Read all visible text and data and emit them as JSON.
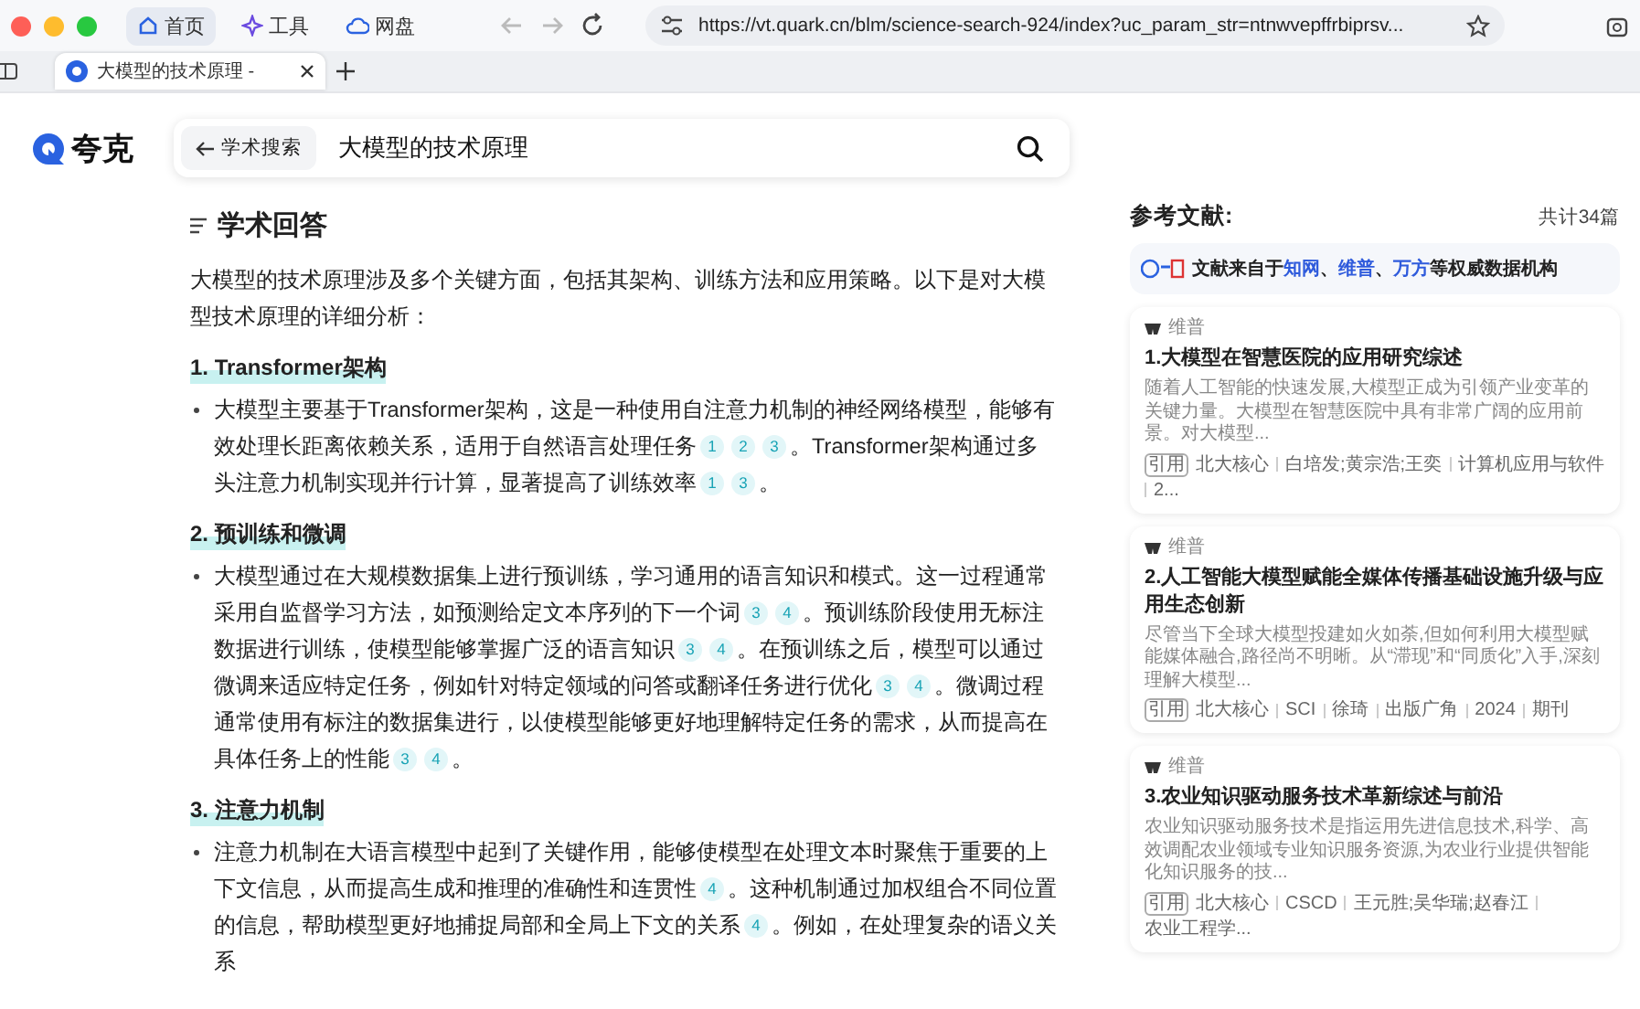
{
  "browser": {
    "nav_tabs": [
      {
        "label": "首页",
        "selected": true
      },
      {
        "label": "工具",
        "selected": false
      },
      {
        "label": "网盘",
        "selected": false
      }
    ],
    "url": "https://vt.quark.cn/blm/science-search-924/index?uc_param_str=ntnwvepffrbiprsv...",
    "tabs": [
      {
        "title": "大模型的技术原理 -",
        "selected": true
      }
    ]
  },
  "header": {
    "logo": "夸克",
    "back_label": "学术搜索",
    "query": "大模型的技术原理"
  },
  "answer": {
    "title": "学术回答",
    "intro": "大模型的技术原理涉及多个关键方面，包括其架构、训练方法和应用策略。以下是对大模型技术原理的详细分析：",
    "sections": [
      {
        "title": "1. Transformer架构",
        "parts": [
          {
            "text": "大模型主要基于Transformer架构，这是一种使用自注意力机制的神经网络模型，能够有效处理长距离依赖关系，适用于自然语言处理任务"
          },
          {
            "cites": [
              "1",
              "2",
              "3"
            ]
          },
          {
            "text": "。Transformer架构通过多头注意力机制实现并行计算，显著提高了训练效率"
          },
          {
            "cites": [
              "1",
              "3"
            ]
          },
          {
            "text": "。"
          }
        ]
      },
      {
        "title": "2. 预训练和微调",
        "parts": [
          {
            "text": "大模型通过在大规模数据集上进行预训练，学习通用的语言知识和模式。这一过程通常采用自监督学习方法，如预测给定文本序列的下一个词"
          },
          {
            "cites": [
              "3",
              "4"
            ]
          },
          {
            "text": "。预训练阶段使用无标注数据进行训练，使模型能够掌握广泛的语言知识"
          },
          {
            "cites": [
              "3",
              "4"
            ]
          },
          {
            "text": "。在预训练之后，模型可以通过微调来适应特定任务，例如针对特定领域的问答或翻译任务进行优化"
          },
          {
            "cites": [
              "3",
              "4"
            ]
          },
          {
            "text": "。微调过程通常使用有标注的数据集进行，以使模型能够更好地理解特定任务的需求，从而提高在具体任务上的性能"
          },
          {
            "cites": [
              "3",
              "4"
            ]
          },
          {
            "text": "。"
          }
        ]
      },
      {
        "title": "3. 注意力机制",
        "parts": [
          {
            "text": "注意力机制在大语言模型中起到了关键作用，能够使模型在处理文本时聚焦于重要的上下文信息，从而提高生成和推理的准确性和连贯性"
          },
          {
            "cites": [
              "4"
            ]
          },
          {
            "text": "。这种机制通过加权组合不同位置的信息，帮助模型更好地捕捉局部和全局上下文的关系"
          },
          {
            "cites": [
              "4"
            ]
          },
          {
            "text": "。例如，在处理复杂的语义关系"
          }
        ]
      }
    ]
  },
  "references": {
    "title": "参考文献:",
    "count": "共计34篇",
    "banner": [
      {
        "text": "文献来自于",
        "link": false
      },
      {
        "text": "知网",
        "link": true
      },
      {
        "text": "、",
        "link": false
      },
      {
        "text": "维普",
        "link": true
      },
      {
        "text": "、",
        "link": false
      },
      {
        "text": "万方",
        "link": true
      },
      {
        "text": "等权威数据机构",
        "link": false
      }
    ],
    "items": [
      {
        "source": "维普",
        "title": "1.大模型在智慧医院的应用研究综述",
        "abstract": "随着人工智能的快速发展,大模型正成为引领产业变革的关键力量。大模型在智慧医院中具有非常广阔的应用前景。对大模型...",
        "tag": "引用",
        "meta": [
          "北大核心",
          "白培发;黄宗浩;王奕",
          "计算机应用与软件",
          "2..."
        ]
      },
      {
        "source": "维普",
        "title": "2.人工智能大模型赋能全媒体传播基础设施升级与应用生态创新",
        "abstract": "尽管当下全球大模型投建如火如荼,但如何利用大模型赋能媒体融合,路径尚不明晰。从“滞现”和“同质化”入手,深刻理解大模型...",
        "tag": "引用",
        "meta": [
          "北大核心",
          "SCI",
          "徐琦",
          "出版广角",
          "2024",
          "期刊"
        ]
      },
      {
        "source": "维普",
        "title": "3.农业知识驱动服务技术革新综述与前沿",
        "abstract": "农业知识驱动服务技术是指运用先进信息技术,科学、高效调配农业领域专业知识服务资源,为农业行业提供智能化知识服务的技...",
        "tag": "引用",
        "meta": [
          "北大核心",
          "CSCD",
          "王元胜;吴华瑞;赵春江",
          "农业工程学..."
        ]
      }
    ]
  }
}
